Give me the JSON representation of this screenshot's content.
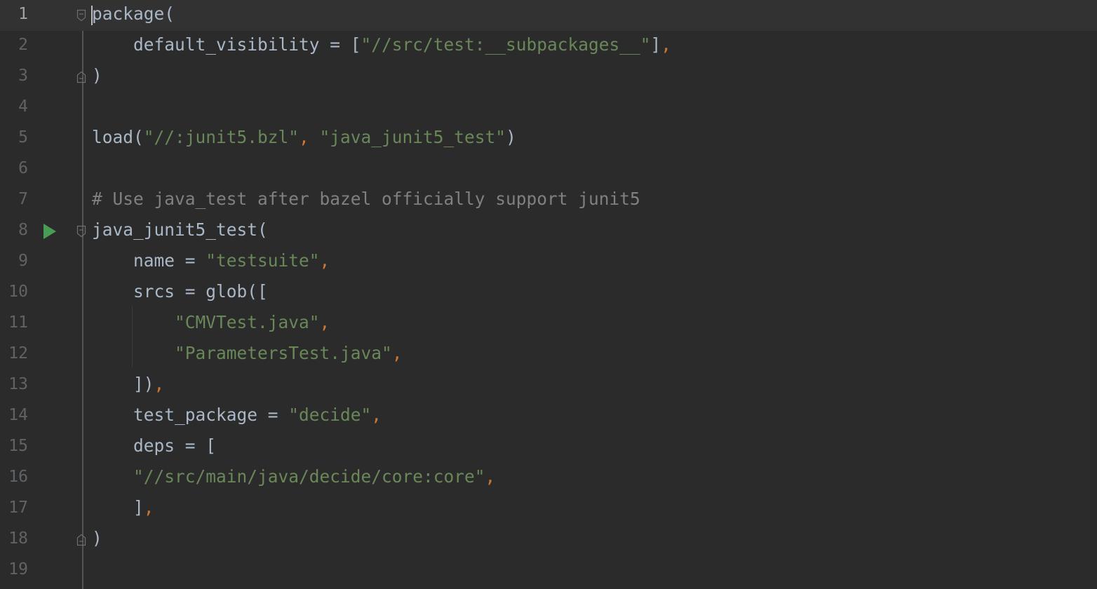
{
  "editor": {
    "caret_line": 1,
    "lines": [
      {
        "n": "1",
        "tokens": [
          {
            "t": "package(",
            "c": "default"
          }
        ]
      },
      {
        "n": "2",
        "tokens": [
          {
            "t": "    default_visibility = [",
            "c": "default"
          },
          {
            "t": "\"//src/test:__subpackages__\"",
            "c": "string"
          },
          {
            "t": "]",
            "c": "default"
          },
          {
            "t": ",",
            "c": "comma"
          }
        ]
      },
      {
        "n": "3",
        "tokens": [
          {
            "t": ")",
            "c": "default"
          }
        ]
      },
      {
        "n": "4",
        "tokens": []
      },
      {
        "n": "5",
        "tokens": [
          {
            "t": "load(",
            "c": "default"
          },
          {
            "t": "\"//:junit5.bzl\"",
            "c": "string"
          },
          {
            "t": ", ",
            "c": "comma"
          },
          {
            "t": "\"java_junit5_test\"",
            "c": "string"
          },
          {
            "t": ")",
            "c": "default"
          }
        ]
      },
      {
        "n": "6",
        "tokens": []
      },
      {
        "n": "7",
        "tokens": [
          {
            "t": "# Use java_test after bazel officially support junit5",
            "c": "comment"
          }
        ]
      },
      {
        "n": "8",
        "tokens": [
          {
            "t": "java_junit5_test(",
            "c": "default"
          }
        ]
      },
      {
        "n": "9",
        "tokens": [
          {
            "t": "    name = ",
            "c": "default"
          },
          {
            "t": "\"testsuite\"",
            "c": "string"
          },
          {
            "t": ",",
            "c": "comma"
          }
        ]
      },
      {
        "n": "10",
        "tokens": [
          {
            "t": "    srcs = glob([",
            "c": "default"
          }
        ]
      },
      {
        "n": "11",
        "tokens": [
          {
            "t": "        ",
            "c": "default"
          },
          {
            "t": "\"CMVTest.java\"",
            "c": "string"
          },
          {
            "t": ",",
            "c": "comma"
          }
        ]
      },
      {
        "n": "12",
        "tokens": [
          {
            "t": "        ",
            "c": "default"
          },
          {
            "t": "\"ParametersTest.java\"",
            "c": "string"
          },
          {
            "t": ",",
            "c": "comma"
          }
        ]
      },
      {
        "n": "13",
        "tokens": [
          {
            "t": "    ])",
            "c": "default"
          },
          {
            "t": ",",
            "c": "comma"
          }
        ]
      },
      {
        "n": "14",
        "tokens": [
          {
            "t": "    test_package = ",
            "c": "default"
          },
          {
            "t": "\"decide\"",
            "c": "string"
          },
          {
            "t": ",",
            "c": "comma"
          }
        ]
      },
      {
        "n": "15",
        "tokens": [
          {
            "t": "    deps = [",
            "c": "default"
          }
        ]
      },
      {
        "n": "16",
        "tokens": [
          {
            "t": "    ",
            "c": "default"
          },
          {
            "t": "\"//src/main/java/decide/core:core\"",
            "c": "string"
          },
          {
            "t": ",",
            "c": "comma"
          }
        ]
      },
      {
        "n": "17",
        "tokens": [
          {
            "t": "    ]",
            "c": "default"
          },
          {
            "t": ",",
            "c": "comma"
          }
        ]
      },
      {
        "n": "18",
        "tokens": [
          {
            "t": ")",
            "c": "default"
          }
        ]
      },
      {
        "n": "19",
        "tokens": []
      }
    ],
    "fold_open_lines": [
      1,
      8
    ],
    "fold_close_lines": [
      3,
      18
    ],
    "run_gutter_lines": [
      8
    ],
    "run_icon": "run-play-icon",
    "colors": {
      "background": "#2b2b2b",
      "text": "#a9b7c6",
      "string": "#6a8759",
      "comma": "#cc7832",
      "comment": "#808080",
      "line_number": "#606366",
      "run_icon": "#499c54"
    }
  }
}
